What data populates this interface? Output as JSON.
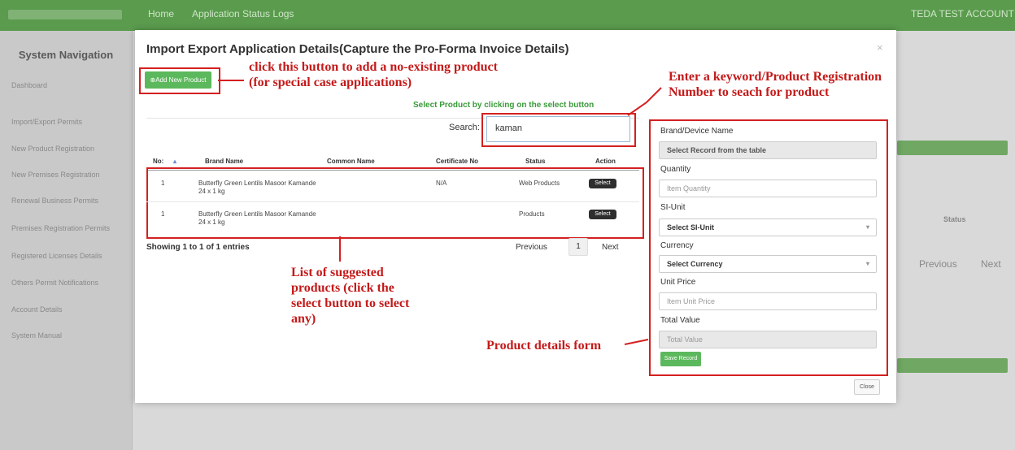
{
  "background": {
    "topbar_items": [
      "Home",
      "Application Status Logs",
      "TEDA TEST ACCOUNT"
    ],
    "sidebar_title": "System Navigation",
    "sidebar_items": [
      "Dashboard",
      "Import/Export Permits",
      "New Product Registration",
      "New Premises Registration",
      "Renewal Business Permits",
      "Premises Registration Permits",
      "Registered Licenses Details",
      "Others Permit Notifications",
      "Account Details",
      "System Manual"
    ],
    "status_header": "Status",
    "previous": "Previous",
    "next": "Next"
  },
  "modal": {
    "title": "Import Export Application Details(Capture the Pro-Forma Invoice Details)",
    "close_x": "×",
    "add_button": "⊕Add New Product",
    "instruction": "Select Product by clicking on the select button",
    "search_label": "Search:",
    "search_value": "kaman",
    "columns": [
      "No:",
      "Brand Name",
      "Common Name",
      "Certificate No",
      "Status",
      "Action"
    ],
    "rows": [
      {
        "no": "1",
        "brand": "Butterfly Green Lentils Masoor Kamande 24 x 1 kg",
        "common": "",
        "cert": "N/A",
        "status": "Web Products",
        "action": "Select"
      },
      {
        "no": "1",
        "brand": "Butterfly Green Lentils Masoor Kamande 24 x 1 kg",
        "common": "",
        "cert": "",
        "status": "Products",
        "action": "Select"
      }
    ],
    "showing": "Showing 1 to 1 of 1 entries",
    "pager": {
      "previous": "Previous",
      "page": "1",
      "next": "Next"
    },
    "form": {
      "brand_label": "Brand/Device Name",
      "brand_value": "Select Record from the table",
      "quantity_label": "Quantity",
      "quantity_placeholder": "Item Quantity",
      "si_label": "SI-Unit",
      "si_value": "Select SI-Unit",
      "currency_label": "Currency",
      "currency_value": "Select Currency",
      "price_label": "Unit Price",
      "price_placeholder": "Item Unit Price",
      "total_label": "Total Value",
      "total_placeholder": "Total Value",
      "save_button": "Save Record"
    },
    "close_button": "Close"
  },
  "annotations": {
    "add_product": "click this button to add a no-existing product (for special case applications)",
    "search": "Enter a keyword/Product Registration Number to seach for product",
    "list": "List of suggested products (click the select button to select any)",
    "form": "Product details form"
  },
  "colors": {
    "annotation": "#d42020",
    "primary_green": "#5cb85c",
    "topbar": "#5a9b4e"
  }
}
